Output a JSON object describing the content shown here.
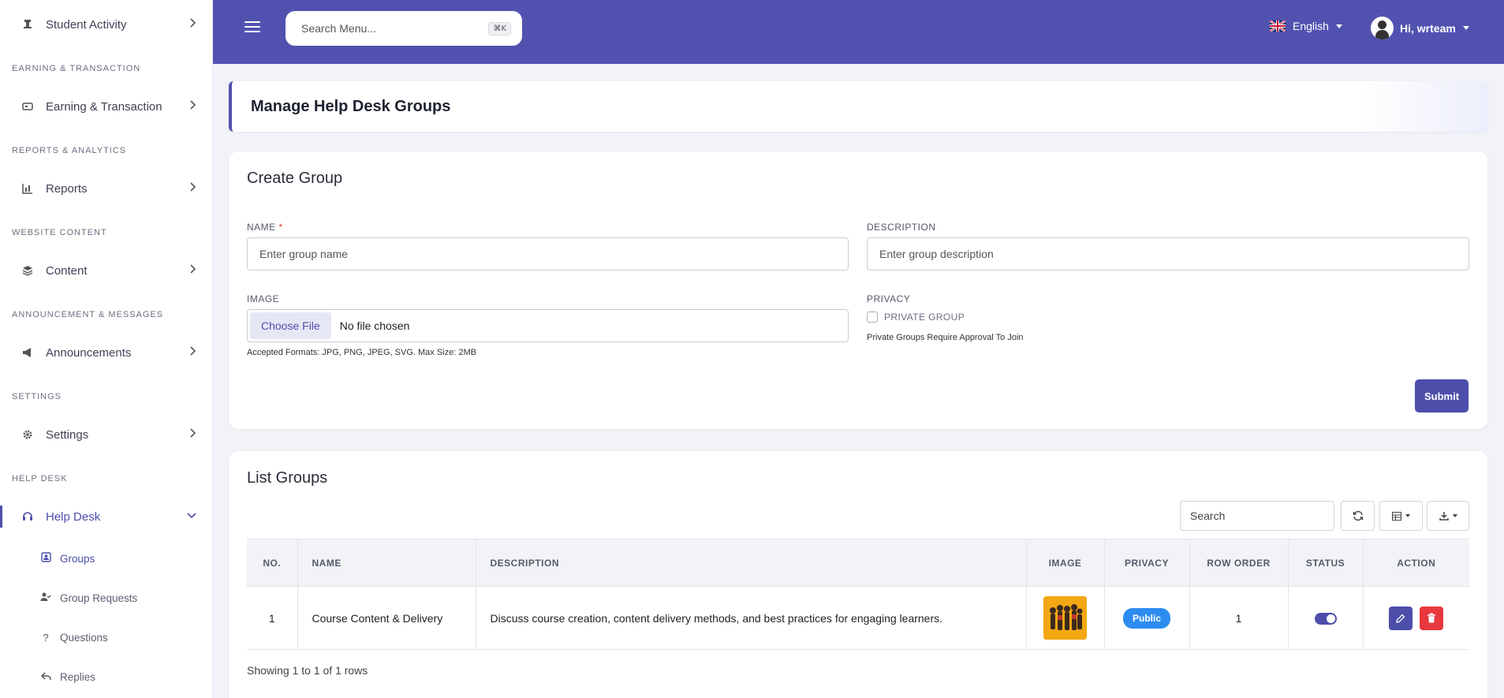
{
  "sidebar": {
    "student_activity": "Student Activity",
    "sections": {
      "earning": "EARNING & TRANSACTION",
      "reports": "REPORTS & ANALYTICS",
      "website": "WEBSITE CONTENT",
      "announcement": "ANNOUNCEMENT & MESSAGES",
      "settings": "SETTINGS",
      "helpdesk": "HELP DESK"
    },
    "items": {
      "earning": "Earning & Transaction",
      "reports": "Reports",
      "content": "Content",
      "announcements": "Announcements",
      "settings": "Settings",
      "helpdesk": "Help Desk"
    },
    "subitems": {
      "groups": "Groups",
      "group_requests": "Group Requests",
      "questions": "Questions",
      "replies": "Replies"
    }
  },
  "topbar": {
    "search_placeholder": "Search Menu...",
    "shortcut": "⌘K",
    "language": "English",
    "greeting": "Hi, wrteam"
  },
  "page": {
    "title": "Manage Help Desk Groups"
  },
  "create_group": {
    "title": "Create Group",
    "name_label": "NAME",
    "required_mark": "*",
    "name_placeholder": "Enter group name",
    "description_label": "DESCRIPTION",
    "description_placeholder": "Enter group description",
    "image_label": "IMAGE",
    "choose_file": "Choose File",
    "no_file": "No file chosen",
    "accepted_formats": "Accepted Formats: JPG, PNG, JPEG, SVG. Max Size: 2MB",
    "privacy_label": "PRIVACY",
    "private_group_label": "PRIVATE GROUP",
    "private_hint": "Private Groups Require Approval To Join",
    "submit": "Submit"
  },
  "list_groups": {
    "title": "List Groups",
    "search_placeholder": "Search",
    "columns": [
      "NO.",
      "NAME",
      "DESCRIPTION",
      "IMAGE",
      "PRIVACY",
      "ROW ORDER",
      "STATUS",
      "ACTION"
    ],
    "rows": [
      {
        "no": "1",
        "name": "Course Content & Delivery",
        "description": "Discuss course creation, content delivery methods, and best practices for engaging learners.",
        "privacy": "Public",
        "row_order": "1",
        "status_on": true
      }
    ],
    "footer": "Showing 1 to 1 of 1 rows"
  },
  "colors": {
    "accent": "#5152b0",
    "danger": "#e8383d",
    "badge": "#2d8cf0"
  }
}
